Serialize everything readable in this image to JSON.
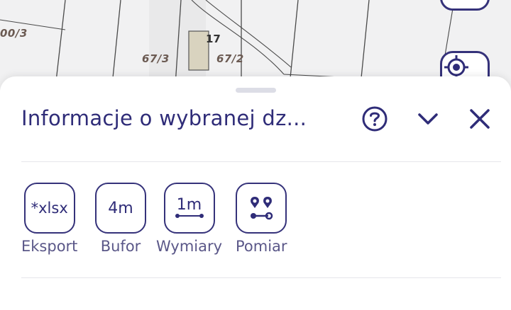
{
  "map": {
    "parcel_labels": [
      "00/3",
      "67/3",
      "67/2"
    ],
    "building_number": "17",
    "buttons": [
      {
        "name": "map-control-button",
        "icon": "menu-icon"
      },
      {
        "name": "locate-button",
        "icon": "crosshair-icon"
      }
    ]
  },
  "panel": {
    "title": "Informacje o wybranej dz...",
    "icons": [
      "help-icon",
      "chevron-down-icon",
      "close-icon"
    ],
    "tools": [
      {
        "label": "Eksport",
        "icon_text": "*xlsx",
        "icon": "xlsx-export-icon"
      },
      {
        "label": "Bufor",
        "icon_text": "4m",
        "icon": "buffer-icon"
      },
      {
        "label": "Wymiary",
        "icon_text": "1m",
        "icon": "dimensions-icon"
      },
      {
        "label": "Pomiar",
        "icon_text": "",
        "icon": "measure-pins-icon"
      }
    ]
  },
  "colors": {
    "accent": "#2f2c78",
    "label_gray": "#5a5788",
    "map_label": "#6b5a52"
  }
}
